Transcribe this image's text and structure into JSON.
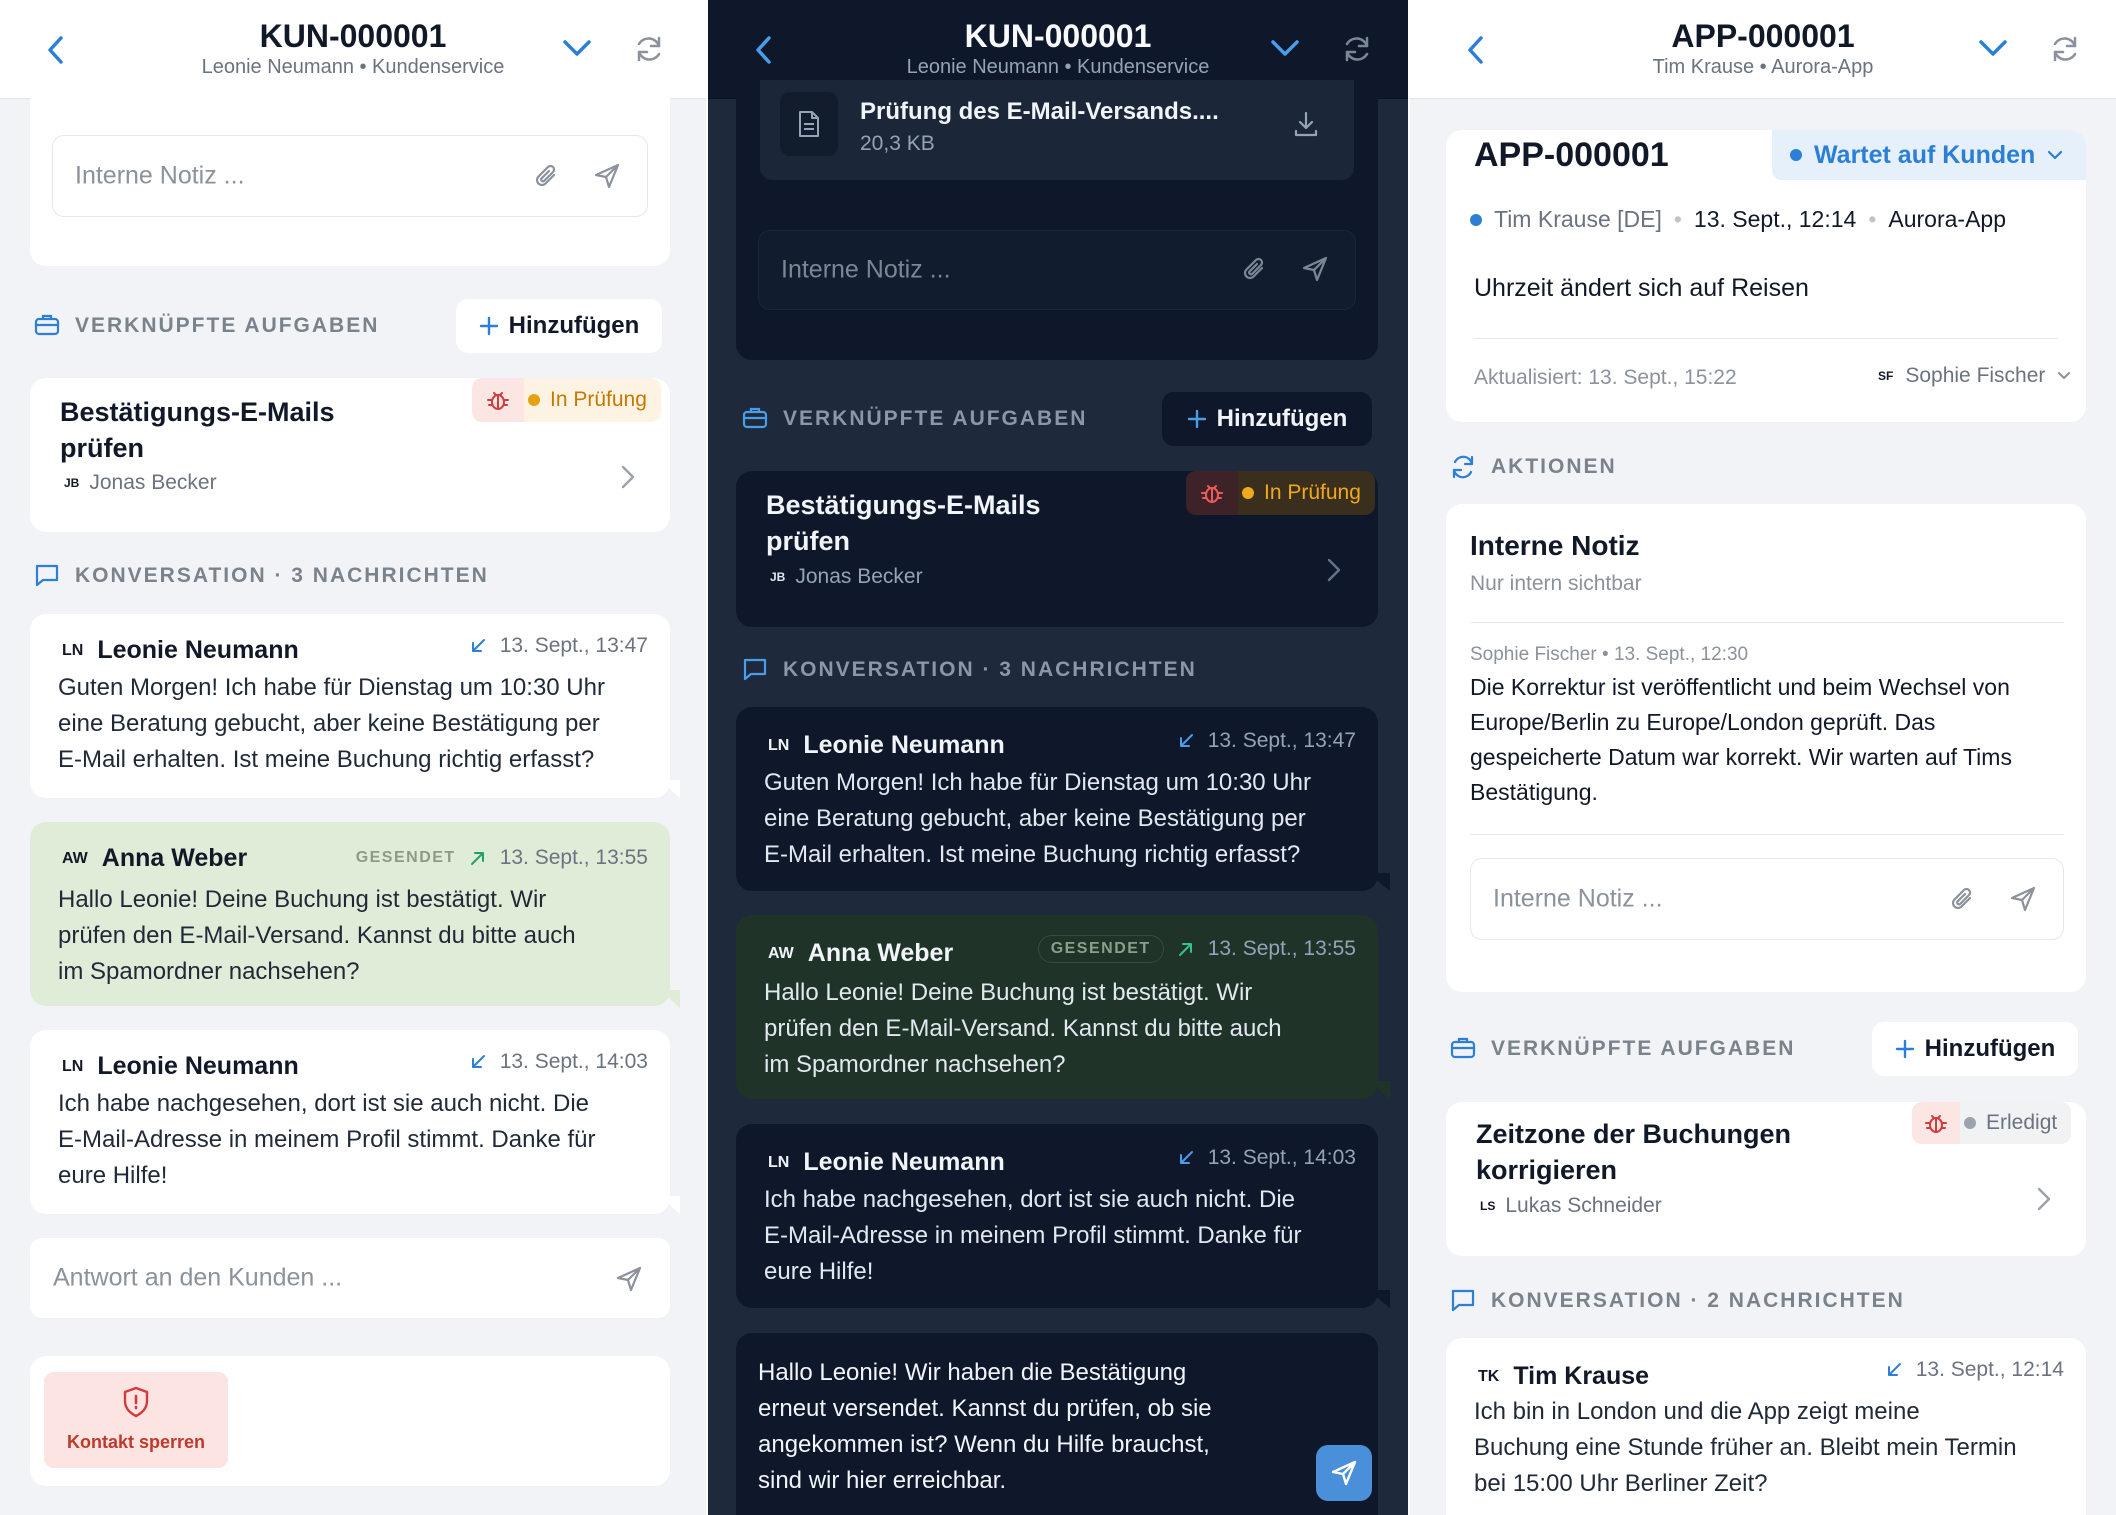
{
  "panel1": {
    "header": {
      "title": "KUN-000001",
      "subtitle": "Leonie Neumann • Kundenservice"
    },
    "note_placeholder": "Interne Notiz ...",
    "tasks_section": {
      "label": "VERKNÜPFTE AUFGABEN",
      "add_label": "Hinzufügen"
    },
    "task": {
      "title_line1": "Bestätigungs-E-Mails",
      "title_line2": "prüfen",
      "assignee_initials": "JB",
      "assignee": "Jonas Becker",
      "status": "In Prüfung"
    },
    "conversation_label": "KONVERSATION · 3 NACHRICHTEN",
    "messages": [
      {
        "initials": "LN",
        "name": "Leonie Neumann",
        "time": "13. Sept., 13:47",
        "lines": [
          "Guten Morgen! Ich habe für Dienstag um 10:30 Uhr",
          "eine Beratung gebucht, aber keine Bestätigung per",
          "E-Mail erhalten. Ist meine Buchung richtig erfasst?"
        ]
      },
      {
        "initials": "AW",
        "name": "Anna Weber",
        "badge": "GESENDET",
        "time": "13. Sept., 13:55",
        "lines": [
          "Hallo Leonie! Deine Buchung ist bestätigt. Wir",
          "prüfen den E-Mail-Versand. Kannst du bitte auch",
          "im Spamordner nachsehen?"
        ]
      },
      {
        "initials": "LN",
        "name": "Leonie Neumann",
        "time": "13. Sept., 14:03",
        "lines": [
          "Ich habe nachgesehen, dort ist sie auch nicht. Die",
          "E-Mail-Adresse in meinem Profil stimmt. Danke für",
          "eure Hilfe!"
        ]
      }
    ],
    "reply_placeholder": "Antwort an den Kunden ...",
    "block_label": "Kontakt sperren"
  },
  "panel2": {
    "header": {
      "title": "KUN-000001",
      "subtitle": "Leonie Neumann • Kundenservice"
    },
    "attachment": {
      "name": "Prüfung des E-Mail-Versands....",
      "size": "20,3 KB"
    },
    "note_placeholder": "Interne Notiz ...",
    "tasks_section": {
      "label": "VERKNÜPFTE AUFGABEN",
      "add_label": "Hinzufügen"
    },
    "task": {
      "title_line1": "Bestätigungs-E-Mails",
      "title_line2": "prüfen",
      "assignee_initials": "JB",
      "assignee": "Jonas Becker",
      "status": "In Prüfung"
    },
    "conversation_label": "KONVERSATION · 3 NACHRICHTEN",
    "messages": [
      {
        "initials": "LN",
        "name": "Leonie Neumann",
        "time": "13. Sept., 13:47",
        "lines": [
          "Guten Morgen! Ich habe für Dienstag um 10:30 Uhr",
          "eine Beratung gebucht, aber keine Bestätigung per",
          "E-Mail erhalten. Ist meine Buchung richtig erfasst?"
        ]
      },
      {
        "initials": "AW",
        "name": "Anna Weber",
        "badge": "GESENDET",
        "time": "13. Sept., 13:55",
        "lines": [
          "Hallo Leonie! Deine Buchung ist bestätigt. Wir",
          "prüfen den E-Mail-Versand. Kannst du bitte auch",
          "im Spamordner nachsehen?"
        ]
      },
      {
        "initials": "LN",
        "name": "Leonie Neumann",
        "time": "13. Sept., 14:03",
        "lines": [
          "Ich habe nachgesehen, dort ist sie auch nicht. Die",
          "E-Mail-Adresse in meinem Profil stimmt. Danke für",
          "eure Hilfe!"
        ]
      }
    ],
    "reply_lines": [
      "Hallo Leonie! Wir haben die Bestätigung",
      "erneut versendet. Kannst du prüfen, ob sie",
      "angekommen ist? Wenn du Hilfe brauchst,",
      "sind wir hier erreichbar."
    ]
  },
  "panel3": {
    "header": {
      "title": "APP-000001",
      "subtitle": "Tim Krause • Aurora-App"
    },
    "ticket": {
      "id": "APP-000001",
      "status": "Wartet auf Kunden",
      "customer": "Tim Krause [DE]",
      "date": "13. Sept., 12:14",
      "app": "Aurora-App",
      "subject": "Uhrzeit ändert sich auf Reisen",
      "updated": "Aktualisiert: 13. Sept., 15:22",
      "assignee_initials": "SF",
      "assignee": "Sophie Fischer"
    },
    "actions_label": "AKTIONEN",
    "note": {
      "title": "Interne Notiz",
      "subtitle": "Nur intern sichtbar",
      "meta": "Sophie Fischer • 13. Sept., 12:30",
      "lines": [
        "Die Korrektur ist veröffentlicht und beim Wechsel von",
        "Europe/Berlin zu Europe/London geprüft. Das",
        "gespeicherte Datum war korrekt. Wir warten auf Tims",
        "Bestätigung."
      ],
      "placeholder": "Interne Notiz ..."
    },
    "tasks_section": {
      "label": "VERKNÜPFTE AUFGABEN",
      "add_label": "Hinzufügen"
    },
    "task": {
      "title_line1": "Zeitzone der Buchungen",
      "title_line2": "korrigieren",
      "assignee_initials": "LS",
      "assignee": "Lukas Schneider",
      "status": "Erledigt"
    },
    "conversation_label": "KONVERSATION · 2 NACHRICHTEN",
    "message": {
      "initials": "TK",
      "name": "Tim Krause",
      "time": "13. Sept., 12:14",
      "lines": [
        "Ich bin in London und die App zeigt meine",
        "Buchung eine Stunde früher an. Bleibt mein Termin",
        "bei 15:00 Uhr Berliner Zeit?"
      ]
    }
  },
  "colors": {
    "accent_blue": "#2b7fd6",
    "review_orange": "#c77800",
    "bug_red": "#d33a3a",
    "sent_green_light": "#dfecd8",
    "sent_green_dark": "#1f3328",
    "done_gray": "#6b7280"
  },
  "icons": [
    "back-chevron-icon",
    "chevron-down-icon",
    "refresh-icon",
    "paperclip-icon",
    "send-icon",
    "briefcase-icon",
    "plus-icon",
    "bug-icon",
    "chevron-right-icon",
    "chat-icon",
    "incoming-arrow-icon",
    "outgoing-arrow-icon",
    "shield-alert-icon",
    "document-icon",
    "download-icon",
    "sync-icon"
  ]
}
